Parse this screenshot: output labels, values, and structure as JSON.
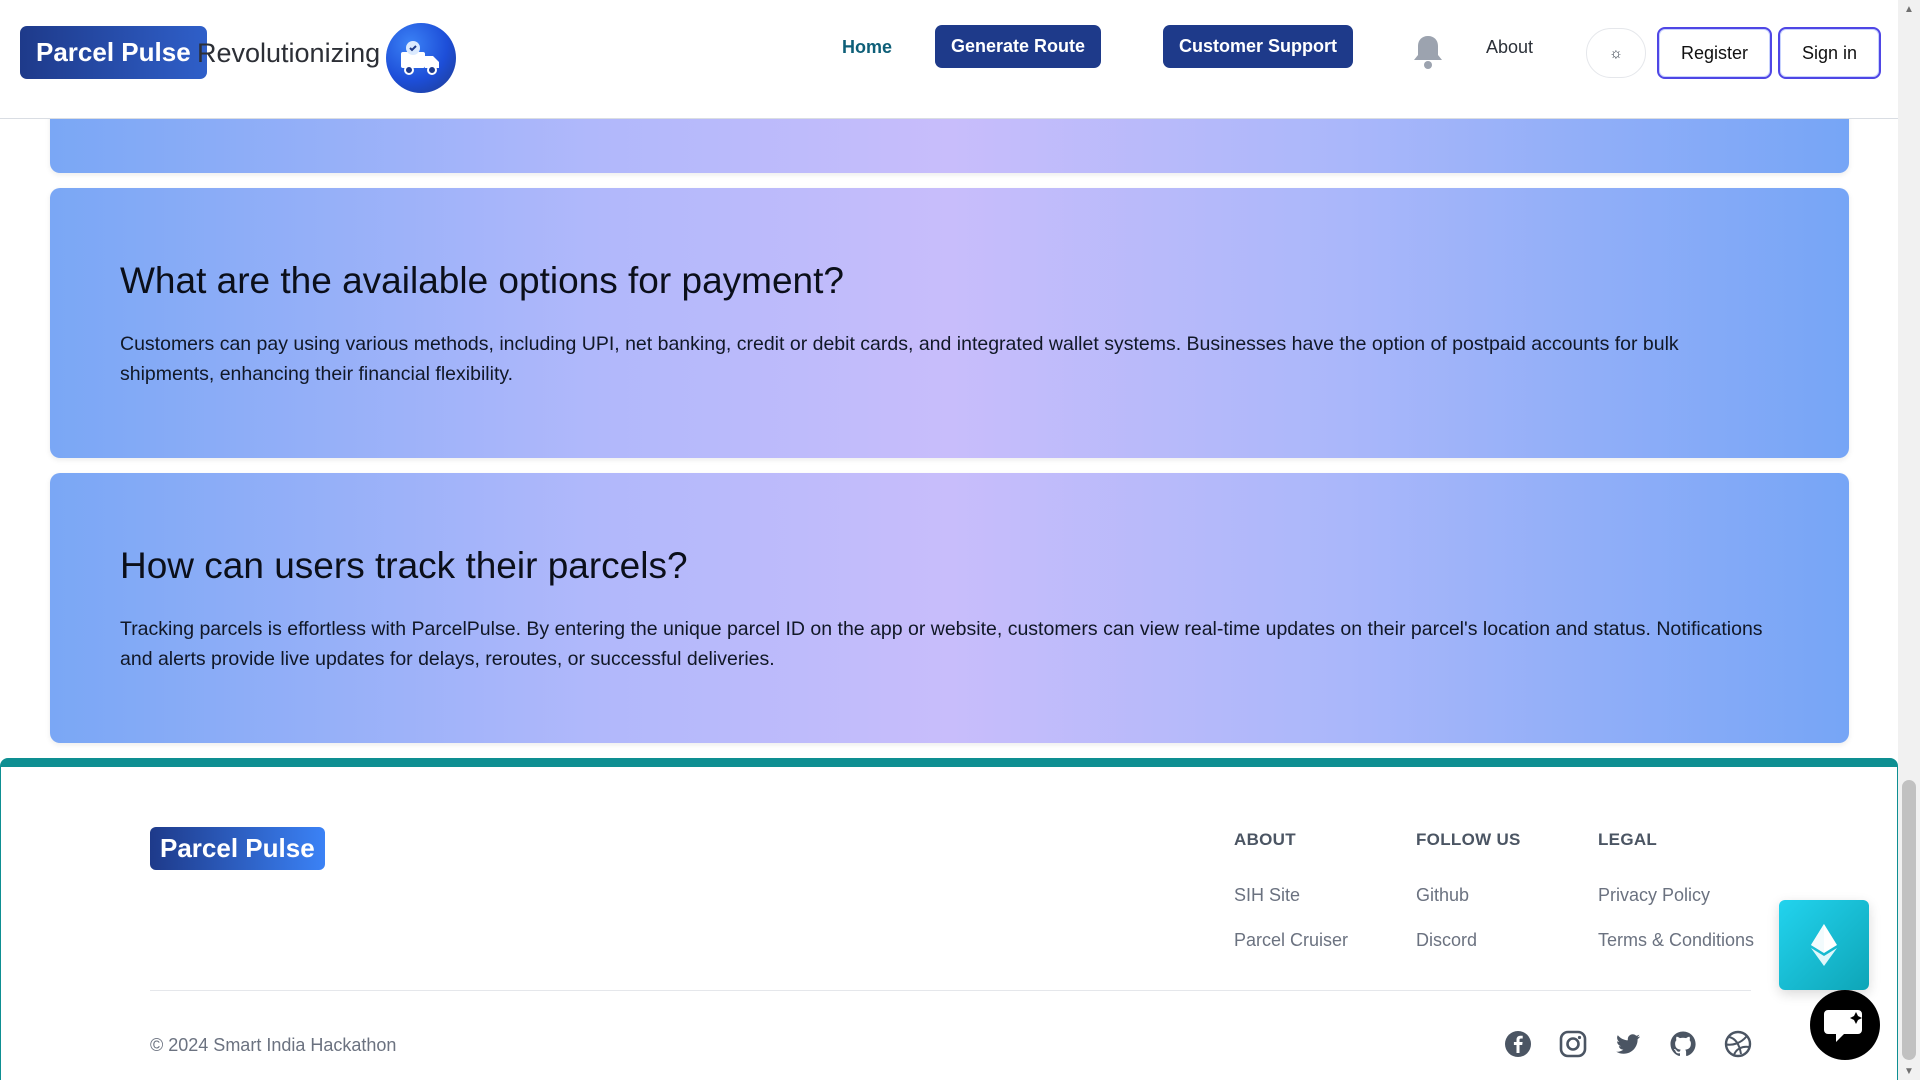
{
  "header": {
    "brand": "Parcel Pulse",
    "tagline": "Revolutionizing",
    "emblem_icon": "delivery-truck-icon",
    "nav": {
      "home": "Home",
      "generate_route": "Generate Route",
      "customer_support": "Customer Support",
      "about": "About"
    },
    "theme_toggle_icon": "sun-icon",
    "theme_toggle_glyph": "☼",
    "register": "Register",
    "sign_in": "Sign in",
    "colors": {
      "primary": "#1e3a8a",
      "link": "#0e5f78",
      "outline": "#4f46e5"
    }
  },
  "faq": [
    {
      "question": "",
      "answer": ""
    },
    {
      "question": "What are the available options for payment?",
      "answer": "Customers can pay using various methods, including UPI, net banking, credit or debit cards, and integrated wallet systems. Businesses have the option of postpaid accounts for bulk shipments, enhancing their financial flexibility."
    },
    {
      "question": "How can users track their parcels?",
      "answer": "Tracking parcels is effortless with ParcelPulse. By entering the unique parcel ID on the app or website, customers can view real-time updates on their parcel's location and status. Notifications and alerts provide live updates for delays, reroutes, or successful deliveries."
    }
  ],
  "footer": {
    "logo": "Parcel Pulse",
    "columns": [
      {
        "title": "ABOUT",
        "links": [
          "SIH Site",
          "Parcel Cruiser"
        ]
      },
      {
        "title": "FOLLOW US",
        "links": [
          "Github",
          "Discord"
        ]
      },
      {
        "title": "LEGAL",
        "links": [
          "Privacy Policy",
          "Terms & Conditions"
        ]
      }
    ],
    "copyright": "© 2024 Smart India Hackathon",
    "social_icons": [
      "facebook-icon",
      "instagram-icon",
      "twitter-icon",
      "github-icon",
      "dribbble-icon"
    ],
    "accent_color": "#0e8f92"
  },
  "floating": {
    "ethereum_icon": "ethereum-icon",
    "chat_icon": "chat-bot-icon"
  }
}
